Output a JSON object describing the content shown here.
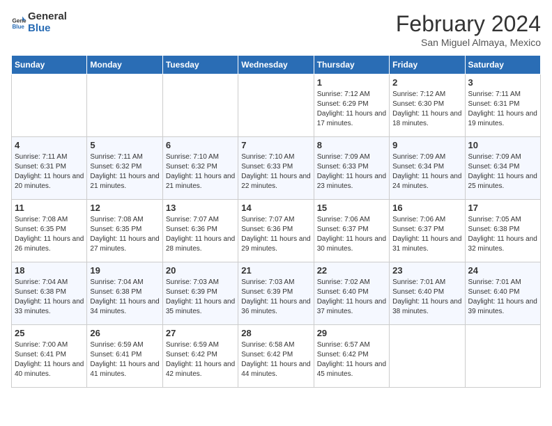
{
  "header": {
    "logo_general": "General",
    "logo_blue": "Blue",
    "title": "February 2024",
    "subtitle": "San Miguel Almaya, Mexico"
  },
  "weekdays": [
    "Sunday",
    "Monday",
    "Tuesday",
    "Wednesday",
    "Thursday",
    "Friday",
    "Saturday"
  ],
  "weeks": [
    [
      {
        "day": "",
        "info": ""
      },
      {
        "day": "",
        "info": ""
      },
      {
        "day": "",
        "info": ""
      },
      {
        "day": "",
        "info": ""
      },
      {
        "day": "1",
        "info": "Sunrise: 7:12 AM\nSunset: 6:29 PM\nDaylight: 11 hours and 17 minutes."
      },
      {
        "day": "2",
        "info": "Sunrise: 7:12 AM\nSunset: 6:30 PM\nDaylight: 11 hours and 18 minutes."
      },
      {
        "day": "3",
        "info": "Sunrise: 7:11 AM\nSunset: 6:31 PM\nDaylight: 11 hours and 19 minutes."
      }
    ],
    [
      {
        "day": "4",
        "info": "Sunrise: 7:11 AM\nSunset: 6:31 PM\nDaylight: 11 hours and 20 minutes."
      },
      {
        "day": "5",
        "info": "Sunrise: 7:11 AM\nSunset: 6:32 PM\nDaylight: 11 hours and 21 minutes."
      },
      {
        "day": "6",
        "info": "Sunrise: 7:10 AM\nSunset: 6:32 PM\nDaylight: 11 hours and 21 minutes."
      },
      {
        "day": "7",
        "info": "Sunrise: 7:10 AM\nSunset: 6:33 PM\nDaylight: 11 hours and 22 minutes."
      },
      {
        "day": "8",
        "info": "Sunrise: 7:09 AM\nSunset: 6:33 PM\nDaylight: 11 hours and 23 minutes."
      },
      {
        "day": "9",
        "info": "Sunrise: 7:09 AM\nSunset: 6:34 PM\nDaylight: 11 hours and 24 minutes."
      },
      {
        "day": "10",
        "info": "Sunrise: 7:09 AM\nSunset: 6:34 PM\nDaylight: 11 hours and 25 minutes."
      }
    ],
    [
      {
        "day": "11",
        "info": "Sunrise: 7:08 AM\nSunset: 6:35 PM\nDaylight: 11 hours and 26 minutes."
      },
      {
        "day": "12",
        "info": "Sunrise: 7:08 AM\nSunset: 6:35 PM\nDaylight: 11 hours and 27 minutes."
      },
      {
        "day": "13",
        "info": "Sunrise: 7:07 AM\nSunset: 6:36 PM\nDaylight: 11 hours and 28 minutes."
      },
      {
        "day": "14",
        "info": "Sunrise: 7:07 AM\nSunset: 6:36 PM\nDaylight: 11 hours and 29 minutes."
      },
      {
        "day": "15",
        "info": "Sunrise: 7:06 AM\nSunset: 6:37 PM\nDaylight: 11 hours and 30 minutes."
      },
      {
        "day": "16",
        "info": "Sunrise: 7:06 AM\nSunset: 6:37 PM\nDaylight: 11 hours and 31 minutes."
      },
      {
        "day": "17",
        "info": "Sunrise: 7:05 AM\nSunset: 6:38 PM\nDaylight: 11 hours and 32 minutes."
      }
    ],
    [
      {
        "day": "18",
        "info": "Sunrise: 7:04 AM\nSunset: 6:38 PM\nDaylight: 11 hours and 33 minutes."
      },
      {
        "day": "19",
        "info": "Sunrise: 7:04 AM\nSunset: 6:38 PM\nDaylight: 11 hours and 34 minutes."
      },
      {
        "day": "20",
        "info": "Sunrise: 7:03 AM\nSunset: 6:39 PM\nDaylight: 11 hours and 35 minutes."
      },
      {
        "day": "21",
        "info": "Sunrise: 7:03 AM\nSunset: 6:39 PM\nDaylight: 11 hours and 36 minutes."
      },
      {
        "day": "22",
        "info": "Sunrise: 7:02 AM\nSunset: 6:40 PM\nDaylight: 11 hours and 37 minutes."
      },
      {
        "day": "23",
        "info": "Sunrise: 7:01 AM\nSunset: 6:40 PM\nDaylight: 11 hours and 38 minutes."
      },
      {
        "day": "24",
        "info": "Sunrise: 7:01 AM\nSunset: 6:40 PM\nDaylight: 11 hours and 39 minutes."
      }
    ],
    [
      {
        "day": "25",
        "info": "Sunrise: 7:00 AM\nSunset: 6:41 PM\nDaylight: 11 hours and 40 minutes."
      },
      {
        "day": "26",
        "info": "Sunrise: 6:59 AM\nSunset: 6:41 PM\nDaylight: 11 hours and 41 minutes."
      },
      {
        "day": "27",
        "info": "Sunrise: 6:59 AM\nSunset: 6:42 PM\nDaylight: 11 hours and 42 minutes."
      },
      {
        "day": "28",
        "info": "Sunrise: 6:58 AM\nSunset: 6:42 PM\nDaylight: 11 hours and 44 minutes."
      },
      {
        "day": "29",
        "info": "Sunrise: 6:57 AM\nSunset: 6:42 PM\nDaylight: 11 hours and 45 minutes."
      },
      {
        "day": "",
        "info": ""
      },
      {
        "day": "",
        "info": ""
      }
    ]
  ]
}
